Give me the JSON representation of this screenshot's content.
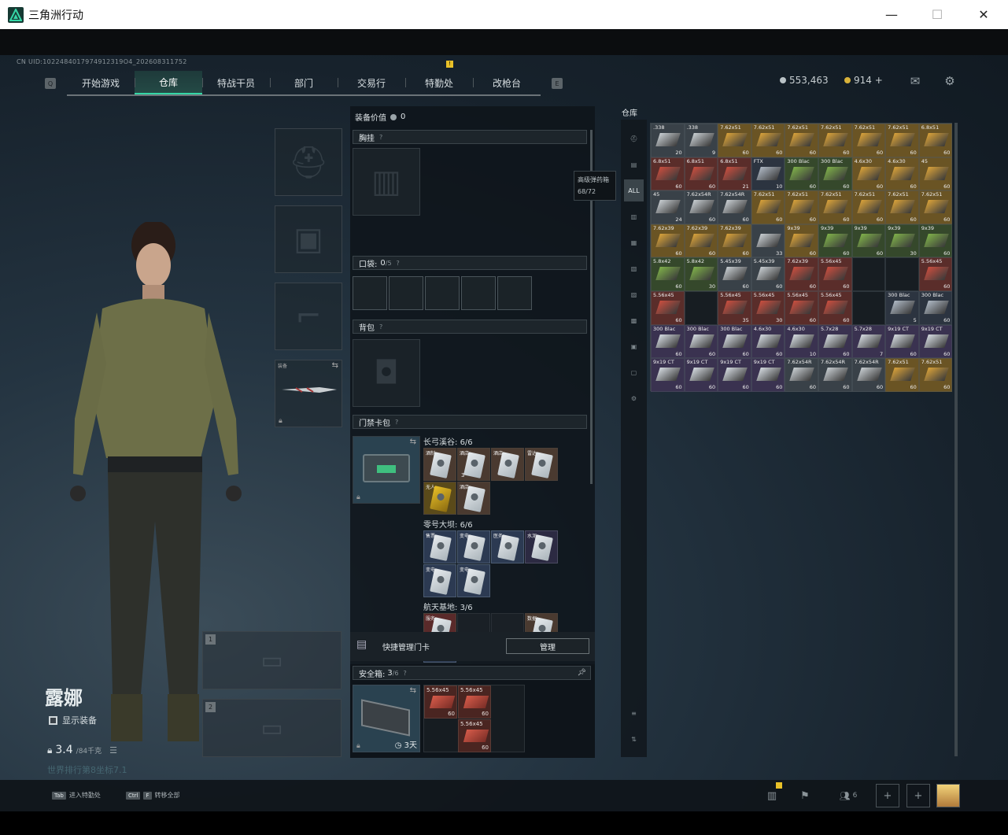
{
  "window": {
    "title": "三角洲行动",
    "controls": [
      "—",
      "☐",
      "✕"
    ]
  },
  "header": {
    "uid": "CN UID:1022484017974912319O4_202608311752",
    "key_left": "Q",
    "key_right": "E",
    "tabs": [
      "开始游戏",
      "仓库",
      "特战干员",
      "部门",
      "交易行",
      "特勤处",
      "改枪台"
    ],
    "active_tab": 1,
    "notify_badge": "!",
    "currency_silver": "553,463",
    "currency_gold": "914 +"
  },
  "equipment": {
    "value_label": "装备价值",
    "value": "0",
    "chest_rig": "胸挂",
    "pockets_label": "口袋:",
    "pockets_used": "0",
    "pockets_total": "/5",
    "backpack": "背包",
    "keycard_wallet": "门禁卡包",
    "tooltip_name": "高级弹药箱",
    "tooltip_value": "68/72",
    "melee_slot_label": "装备",
    "maps": [
      {
        "name": "长弓溪谷:",
        "count": "6/6",
        "cards": [
          "酒制",
          "酒店",
          "酒店",
          "雷达",
          "无人",
          "酒店"
        ]
      },
      {
        "name": "零号大坝:",
        "count": "6/6",
        "cards": [
          "售票",
          "变电",
          "医务",
          "水泥",
          "变电",
          "变电"
        ]
      },
      {
        "name": "航天基地:",
        "count": "3/6",
        "cards": [
          "服务",
          "数据",
          "观测"
        ]
      }
    ],
    "card_counter": "3",
    "quick_manage": "快捷管理门卡",
    "manage_button": "管理",
    "safe_box_label": "安全箱:",
    "safe_box_used": "3",
    "safe_box_total": "/6",
    "safe_box_days": "3天",
    "safe_items": [
      {
        "name": "5.56x45",
        "count": "60"
      },
      {
        "name": "5.56x45",
        "count": "60"
      },
      {
        "name": "5.56x45",
        "count": "60"
      }
    ]
  },
  "character": {
    "name": "露娜",
    "show_gear": "显示装备",
    "weight": "3.4",
    "weight_max": "/84千克",
    "world_text": "世界排行第8坐标7.1"
  },
  "warehouse": {
    "title": "仓库",
    "sidebar": [
      "⛑",
      "▤",
      "ALL",
      "▥",
      "▦",
      "▧",
      "▨",
      "▩",
      "▣",
      "▢",
      "⚙"
    ],
    "grid": [
      [
        {
          "t": ".338",
          "c": "20",
          "r": "gray"
        },
        {
          "t": ".338",
          "c": "9",
          "r": "gray"
        },
        {
          "t": "7.62x51",
          "c": "60",
          "r": "gold"
        },
        {
          "t": "7.62x51",
          "c": "60",
          "r": "gold"
        },
        {
          "t": "7.62x51",
          "c": "60",
          "r": "gold"
        },
        {
          "t": "7.62x51",
          "c": "60",
          "r": "gold"
        },
        {
          "t": "7.62x51",
          "c": "60",
          "r": "gold"
        },
        {
          "t": "7.62x51",
          "c": "60",
          "r": "gold"
        },
        {
          "t": "6.8x51",
          "c": "60",
          "r": "gold"
        }
      ],
      [
        {
          "t": "6.8x51",
          "c": "60",
          "r": "red"
        },
        {
          "t": "6.8x51",
          "c": "60",
          "r": "red"
        },
        {
          "t": "6.8x51",
          "c": "21",
          "r": "red"
        },
        {
          "t": "FTX",
          "c": "10",
          "r": "blue"
        },
        {
          "t": "300 Blac",
          "c": "60",
          "r": "green"
        },
        {
          "t": "300 Blac",
          "c": "60",
          "r": "green"
        },
        {
          "t": "4.6x30",
          "c": "60",
          "r": "gold"
        },
        {
          "t": "4.6x30",
          "c": "60",
          "r": "gold"
        },
        {
          "t": "45",
          "c": "60",
          "r": "gold"
        }
      ],
      [
        {
          "t": "45",
          "c": "24",
          "r": "gray"
        },
        {
          "t": "7.62x54R",
          "c": "60",
          "r": "gray"
        },
        {
          "t": "7.62x54R",
          "c": "60",
          "r": "gray"
        },
        {
          "t": "7.62x51",
          "c": "60",
          "r": "gold"
        },
        {
          "t": "7.62x51",
          "c": "60",
          "r": "gold"
        },
        {
          "t": "7.62x51",
          "c": "60",
          "r": "gold"
        },
        {
          "t": "7.62x51",
          "c": "60",
          "r": "gold"
        },
        {
          "t": "7.62x51",
          "c": "60",
          "r": "gold"
        },
        {
          "t": "7.62x51",
          "c": "60",
          "r": "gold"
        }
      ],
      [
        {
          "t": "7.62x39",
          "c": "60",
          "r": "gold"
        },
        {
          "t": "7.62x39",
          "c": "60",
          "r": "gold"
        },
        {
          "t": "7.62x39",
          "c": "60",
          "r": "gold"
        },
        {
          "t": "",
          "c": "33",
          "r": "gray"
        },
        {
          "t": "9x39",
          "c": "60",
          "r": "gold"
        },
        {
          "t": "9x39",
          "c": "60",
          "r": "green"
        },
        {
          "t": "9x39",
          "c": "60",
          "r": "green"
        },
        {
          "t": "9x39",
          "c": "30",
          "r": "green"
        },
        {
          "t": "9x39",
          "c": "60",
          "r": "green"
        }
      ],
      [
        {
          "t": "5.8x42",
          "c": "60",
          "r": "green"
        },
        {
          "t": "5.8x42",
          "c": "30",
          "r": "green"
        },
        {
          "t": "5.45x39",
          "c": "60",
          "r": "gray"
        },
        {
          "t": "5.45x39",
          "c": "60",
          "r": "gray"
        },
        {
          "t": "7.62x39",
          "c": "60",
          "r": "red"
        },
        {
          "t": "5.56x45",
          "c": "60",
          "r": "red"
        },
        {
          "t": "",
          "c": "",
          "r": "empty"
        },
        {
          "t": "",
          "c": "",
          "r": "empty"
        },
        {
          "t": "5.56x45",
          "c": "60",
          "r": "red"
        }
      ],
      [
        {
          "t": "5.56x45",
          "c": "60",
          "r": "red"
        },
        {
          "t": "",
          "c": "",
          "r": "empty"
        },
        {
          "t": "5.56x45",
          "c": "35",
          "r": "red"
        },
        {
          "t": "5.56x45",
          "c": "30",
          "r": "red"
        },
        {
          "t": "5.56x45",
          "c": "60",
          "r": "red"
        },
        {
          "t": "5.56x45",
          "c": "60",
          "r": "red"
        },
        {
          "t": "",
          "c": "",
          "r": "empty"
        },
        {
          "t": "300 Blac",
          "c": "5",
          "r": "blue"
        },
        {
          "t": "300 Blac",
          "c": "60",
          "r": "blue"
        }
      ],
      [
        {
          "t": "300 Blac",
          "c": "60",
          "r": "purple"
        },
        {
          "t": "300 Blac",
          "c": "60",
          "r": "purple"
        },
        {
          "t": "300 Blac",
          "c": "60",
          "r": "purple"
        },
        {
          "t": "4.6x30",
          "c": "60",
          "r": "purple"
        },
        {
          "t": "4.6x30",
          "c": "10",
          "r": "purple"
        },
        {
          "t": "5.7x28",
          "c": "60",
          "r": "purple"
        },
        {
          "t": "5.7x28",
          "c": "7",
          "r": "purple"
        },
        {
          "t": "9x19 CT",
          "c": "60",
          "r": "purple"
        },
        {
          "t": "9x19 CT",
          "c": "60",
          "r": "purple"
        }
      ],
      [
        {
          "t": "9x19 CT",
          "c": "60",
          "r": "purple"
        },
        {
          "t": "9x19 CT",
          "c": "60",
          "r": "purple"
        },
        {
          "t": "9x19 CT",
          "c": "60",
          "r": "purple"
        },
        {
          "t": "9x19 CT",
          "c": "60",
          "r": "purple"
        },
        {
          "t": "7.62x54R",
          "c": "60",
          "r": "gray"
        },
        {
          "t": "7.62x54R",
          "c": "60",
          "r": "gray"
        },
        {
          "t": "7.62x54R",
          "c": "60",
          "r": "gray"
        },
        {
          "t": "7.62x51",
          "c": "60",
          "r": "gold"
        },
        {
          "t": "7.62x51",
          "c": "60",
          "r": "gold"
        }
      ]
    ]
  },
  "bottom_bar": {
    "hint1_key": "Tab",
    "hint1": "进入特勤处",
    "hint2_key1": "Ctrl",
    "hint2_key2": "F",
    "hint2": "转移全部",
    "friends": "6"
  },
  "colors": {
    "accent": "#35d6a6",
    "badge": "#e8c028",
    "rarity_red": "#5a2d2a",
    "rarity_gold": "#6a5424",
    "rarity_green": "#35482b",
    "rarity_purple": "#3a3250"
  }
}
